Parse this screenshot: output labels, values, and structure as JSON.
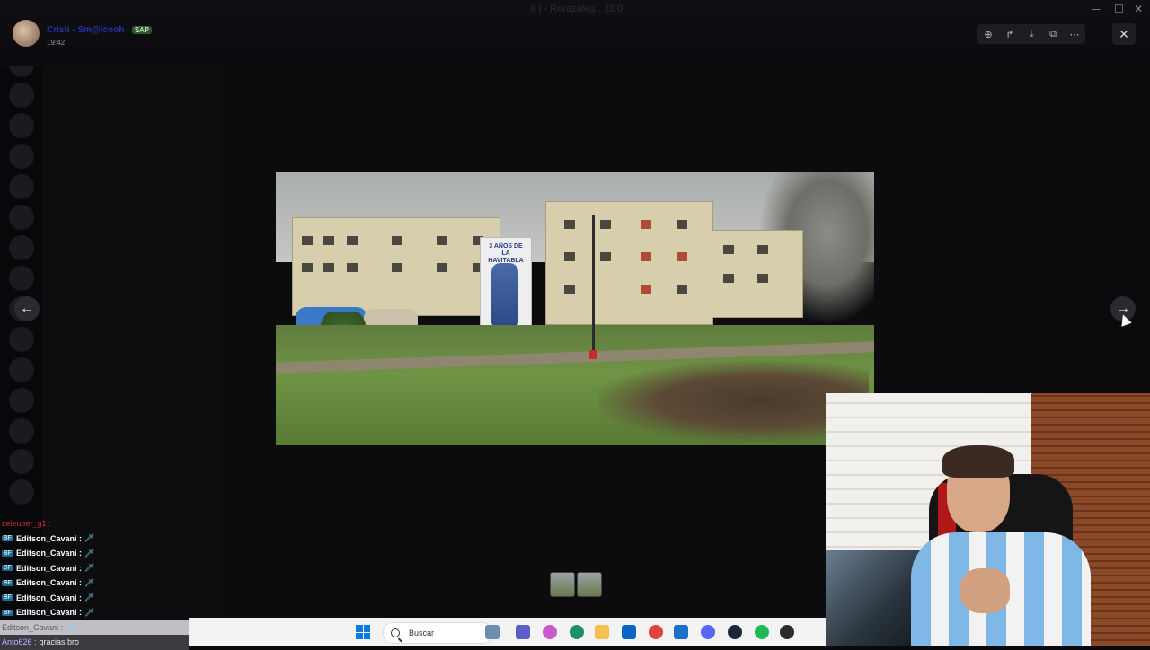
{
  "viewer": {
    "author": "Cristi - Sm@lcooh",
    "author_badge": "SAP",
    "timestamp": "19:42",
    "window_title": "[ # ] - Rerazaleg... [3.0]",
    "tools": [
      "zoom-in-icon",
      "forward-icon",
      "download-icon",
      "open-external-icon",
      "more-icon"
    ],
    "close_label": "✕",
    "prev_label": "←",
    "next_label": "→"
  },
  "image": {
    "mural_text": "3 AÑOS DE LA HAVITABLA"
  },
  "chat": {
    "top_line": "zeleuber_g1 :",
    "lines": [
      {
        "badge": "BF",
        "user": "Editson_Cavani :",
        "msg": "🗡"
      },
      {
        "badge": "BF",
        "user": "Editson_Cavani :",
        "msg": "🗡"
      },
      {
        "badge": "BF",
        "user": "Editson_Cavani :",
        "msg": "🗡"
      },
      {
        "badge": "BF",
        "user": "Editson_Cavani :",
        "msg": "🗡"
      },
      {
        "badge": "BF",
        "user": "Editson_Cavani :",
        "msg": "🗡"
      },
      {
        "badge": "BF",
        "user": "Editson_Cavani :",
        "msg": "🗡"
      }
    ],
    "highlight_line": {
      "user": "Editson_Cavani :",
      "msg": "🗡"
    },
    "last_line": {
      "user": "Anto626 :",
      "msg": "gracias bro"
    }
  },
  "taskbar": {
    "search_label": "Buscar",
    "icons": [
      "windows-icon",
      "shark-icon",
      "teams-icon",
      "copilot-icon",
      "edge-icon",
      "folder-icon",
      "store-icon",
      "chrome-icon",
      "outlook-icon",
      "discord-icon",
      "steam-icon",
      "spotify-icon",
      "obs-icon"
    ],
    "icon_colors": [
      "#6b8fb0",
      "#5b5fc7",
      "#c85ad0",
      "#1e8f6e",
      "#f2c14e",
      "#0a66c2",
      "#e0453a",
      "#1b6fc4",
      "#5865f2",
      "#1b2838",
      "#1db954",
      "#2b2b2b"
    ]
  }
}
